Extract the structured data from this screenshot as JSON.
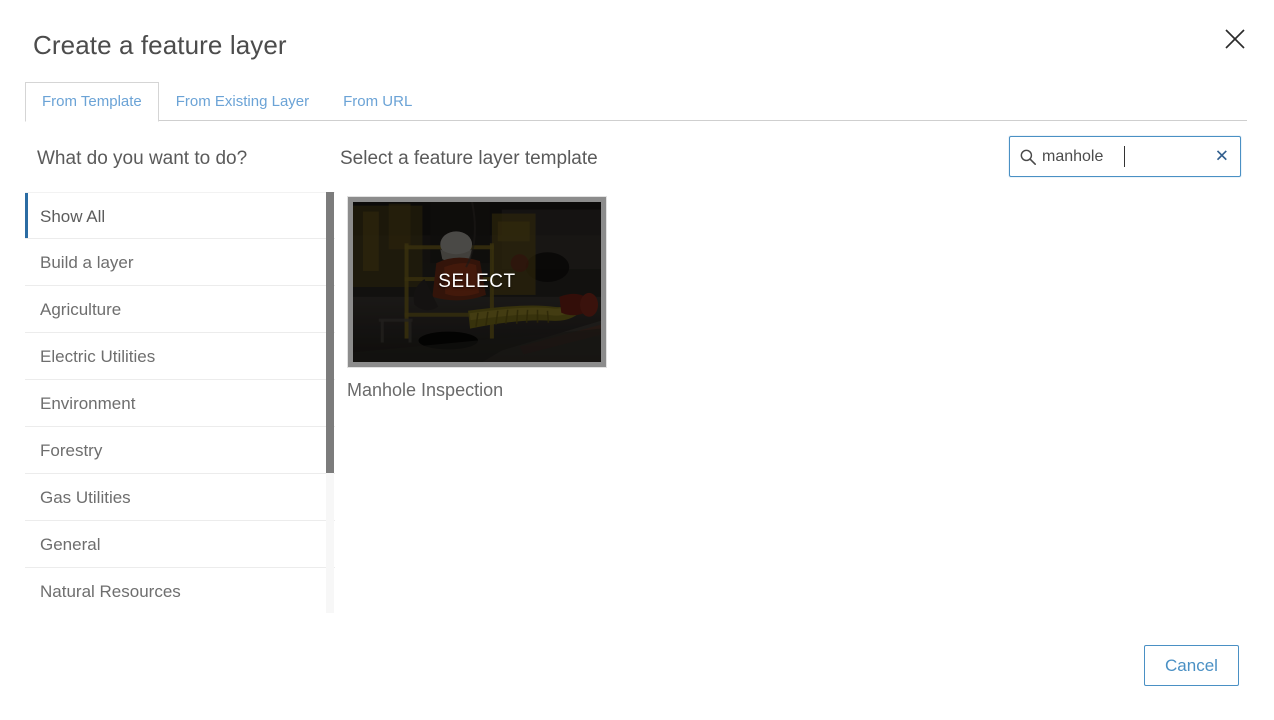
{
  "dialog": {
    "title": "Create a feature layer",
    "close_icon": "close-icon"
  },
  "tabs": [
    {
      "label": "From Template",
      "active": true
    },
    {
      "label": "From Existing Layer",
      "active": false
    },
    {
      "label": "From URL",
      "active": false
    }
  ],
  "headings": {
    "left": "What do you want to do?",
    "right": "Select a feature layer template"
  },
  "search": {
    "value": "manhole",
    "placeholder": "Search",
    "icon": "search-icon",
    "clear_label": "✕",
    "clear_icon": "clear-icon",
    "border_color": "#4a90c4"
  },
  "categories": {
    "selected": "Show All",
    "accent_color": "#2b6ca3",
    "items": [
      {
        "label": "Show All"
      },
      {
        "label": "Build a layer"
      },
      {
        "label": "Agriculture"
      },
      {
        "label": "Electric Utilities"
      },
      {
        "label": "Environment"
      },
      {
        "label": "Forestry"
      },
      {
        "label": "Gas Utilities"
      },
      {
        "label": "General"
      },
      {
        "label": "Natural Resources"
      }
    ]
  },
  "templates": [
    {
      "name": "Manhole Inspection",
      "select_label": "SELECT",
      "thumbnail_alt": "manhole-inspection-photo"
    }
  ],
  "footer": {
    "cancel_label": "Cancel"
  }
}
